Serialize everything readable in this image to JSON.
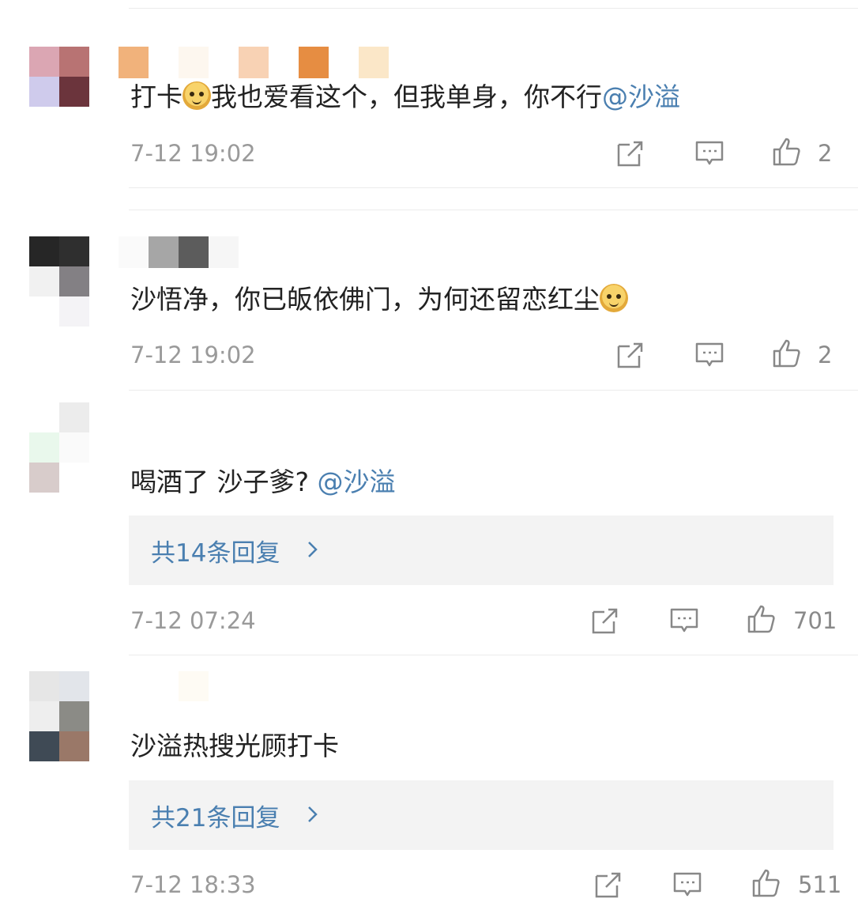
{
  "comments": [
    {
      "text_before": "打卡",
      "has_emoji_inline": true,
      "text_after": "我也爱看这个，但我单身，你不行",
      "mention": "@沙溢",
      "time": "7-12 19:02",
      "likes": "2",
      "replies_label": null
    },
    {
      "text_before": "沙悟净，你已皈依佛门，为何还留恋红尘",
      "has_emoji_end": true,
      "mention": "",
      "time": "7-12 19:02",
      "likes": "2",
      "replies_label": null
    },
    {
      "text_before": "喝酒了 沙子爹? ",
      "mention": "@沙溢",
      "time": "7-12 07:24",
      "likes": "701",
      "replies_label": "共14条回复"
    },
    {
      "text_before": "沙溢热搜光顾打卡",
      "mention": "",
      "time": "7-12 18:33",
      "likes": "511",
      "replies_label": "共21条回复"
    }
  ],
  "icons": {
    "repost": "share-edit-icon",
    "comment": "comment-icon",
    "like": "thumbs-up-icon",
    "chevron": "chevron-right-icon",
    "emoji": "doge-emoji-icon"
  },
  "colors": {
    "mention": "#4a7fb0",
    "meta": "#9a9a9a",
    "reply_bg": "#f3f3f3"
  }
}
